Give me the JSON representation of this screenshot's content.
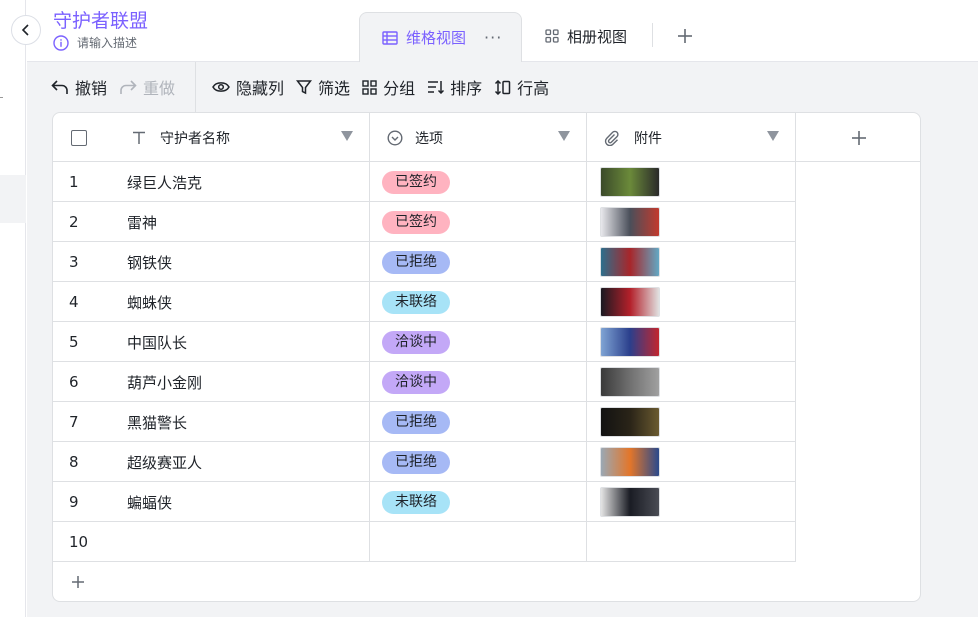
{
  "base": {
    "title": "守护者联盟",
    "description_placeholder": "请输入描述"
  },
  "tabs": [
    {
      "label": "维格视图",
      "icon": "grid-table-icon",
      "active": true
    },
    {
      "label": "相册视图",
      "icon": "album-grid-icon",
      "active": false
    }
  ],
  "toolbar": {
    "undo": "撤销",
    "redo": "重做",
    "hide_columns": "隐藏列",
    "filter": "筛选",
    "group": "分组",
    "sort": "排序",
    "row_height": "行高"
  },
  "columns": [
    {
      "name": "守护者名称",
      "icon": "text-field-icon"
    },
    {
      "name": "选项",
      "icon": "single-select-icon"
    },
    {
      "name": "附件",
      "icon": "paperclip-icon"
    }
  ],
  "option_colors": {
    "已签约": "#ffb3c0",
    "已拒绝": "#a6b9f5",
    "未联络": "#a7e3f7",
    "洽谈中": "#c3a8f7"
  },
  "rows": [
    {
      "no": "1",
      "name": "绿巨人浩克",
      "option": "已签约",
      "thumb": [
        "#3b4a2a",
        "#6b8a3a",
        "#2a2a2a"
      ]
    },
    {
      "no": "2",
      "name": "雷神",
      "option": "已签约",
      "thumb": [
        "#e8e8ec",
        "#4a4f5a",
        "#c23a2e"
      ]
    },
    {
      "no": "3",
      "name": "钢铁侠",
      "option": "已拒绝",
      "thumb": [
        "#2d6f8c",
        "#a8262a",
        "#62a8c4"
      ]
    },
    {
      "no": "4",
      "name": "蜘蛛侠",
      "option": "未联络",
      "thumb": [
        "#1a1a22",
        "#b3202a",
        "#e0e0e0"
      ]
    },
    {
      "no": "5",
      "name": "中国队长",
      "option": "洽谈中",
      "thumb": [
        "#7fa4d4",
        "#2b3f8c",
        "#c2262e"
      ]
    },
    {
      "no": "6",
      "name": "葫芦小金刚",
      "option": "洽谈中",
      "thumb": [
        "#3a3a3a",
        "#707070",
        "#a0a0a0"
      ]
    },
    {
      "no": "7",
      "name": "黑猫警长",
      "option": "已拒绝",
      "thumb": [
        "#121212",
        "#2a2418",
        "#6a5a30"
      ]
    },
    {
      "no": "8",
      "name": "超级赛亚人",
      "option": "已拒绝",
      "thumb": [
        "#9aa8b4",
        "#e3762a",
        "#2a4a8c"
      ]
    },
    {
      "no": "9",
      "name": "蝙蝠侠",
      "option": "未联络",
      "thumb": [
        "#e4e4e4",
        "#1a1c24",
        "#4a4c54"
      ]
    },
    {
      "no": "10",
      "name": "",
      "option": "",
      "thumb": null
    }
  ]
}
